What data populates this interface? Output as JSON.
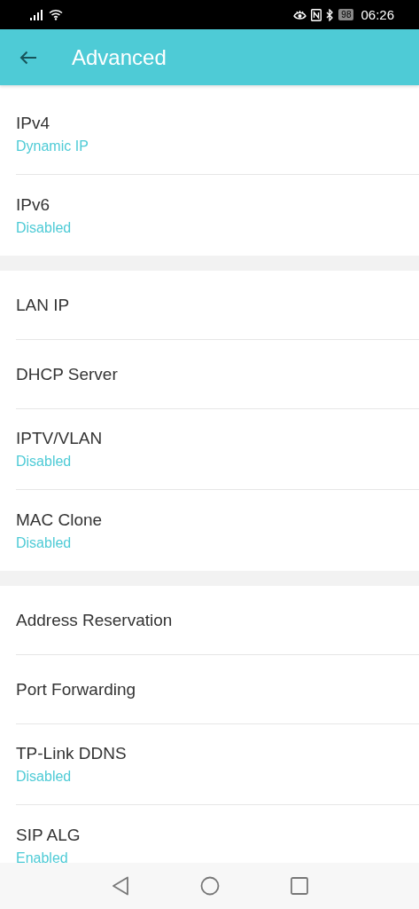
{
  "status_bar": {
    "battery": "98",
    "time": "06:26"
  },
  "header": {
    "title": "Advanced"
  },
  "sections": [
    {
      "items": [
        {
          "title": "IPv4",
          "value": "Dynamic IP"
        },
        {
          "title": "IPv6",
          "value": "Disabled"
        }
      ]
    },
    {
      "items": [
        {
          "title": "LAN IP"
        },
        {
          "title": "DHCP Server"
        },
        {
          "title": "IPTV/VLAN",
          "value": "Disabled"
        },
        {
          "title": "MAC Clone",
          "value": "Disabled"
        }
      ]
    },
    {
      "items": [
        {
          "title": "Address Reservation"
        },
        {
          "title": "Port Forwarding"
        },
        {
          "title": "TP-Link DDNS",
          "value": "Disabled"
        },
        {
          "title": "SIP ALG",
          "value": "Enabled"
        }
      ]
    }
  ]
}
